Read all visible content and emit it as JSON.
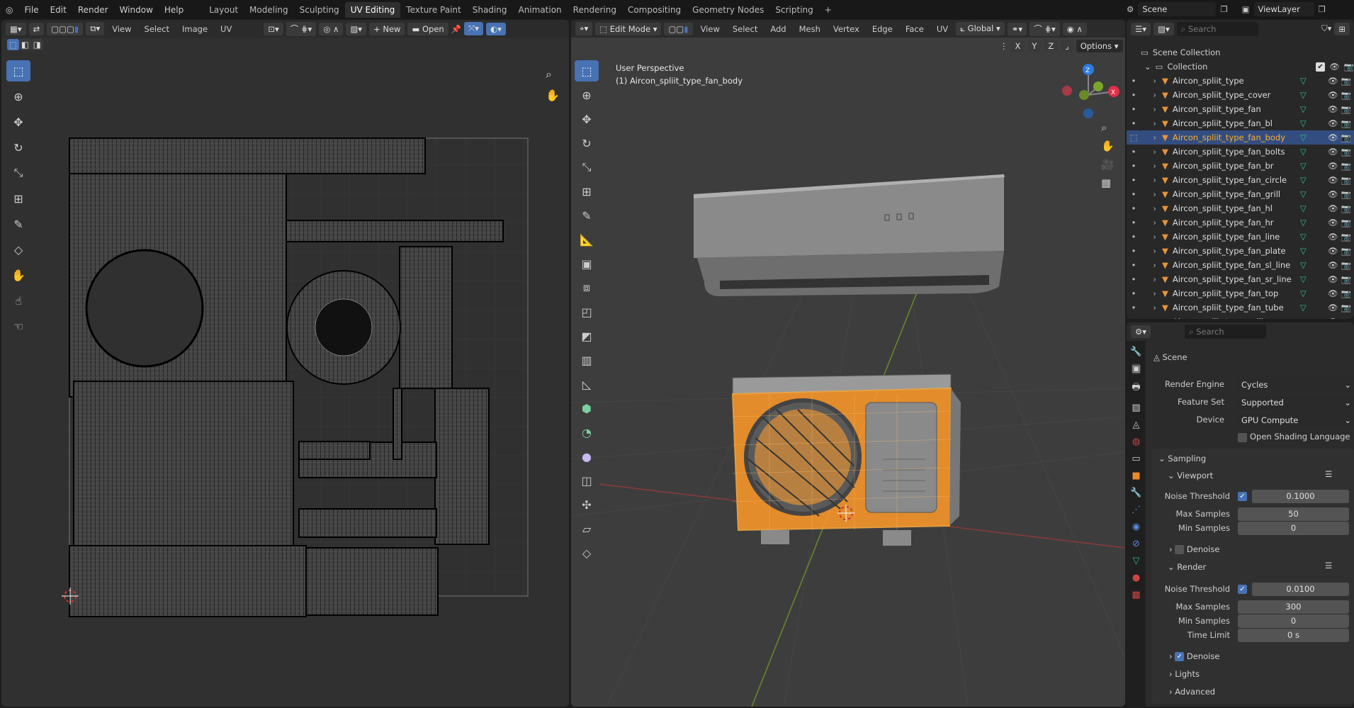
{
  "menu": {
    "items": [
      "File",
      "Edit",
      "Render",
      "Window",
      "Help"
    ],
    "workspaces": [
      "Layout",
      "Modeling",
      "Sculpting",
      "UV Editing",
      "Texture Paint",
      "Shading",
      "Animation",
      "Rendering",
      "Compositing",
      "Geometry Nodes",
      "Scripting"
    ],
    "active_workspace": "UV Editing",
    "add": "+"
  },
  "scene": {
    "name": "Scene",
    "view_layer": "ViewLayer"
  },
  "uv_editor": {
    "menus": [
      "View",
      "Select",
      "Image",
      "UV"
    ],
    "new_label": "New",
    "open_label": "Open"
  },
  "viewport": {
    "mode": "Edit Mode",
    "menus": [
      "View",
      "Select",
      "Add",
      "Mesh",
      "Vertex",
      "Edge",
      "Face",
      "UV"
    ],
    "orientation": "Global",
    "axes": [
      "X",
      "Y",
      "Z"
    ],
    "options": "Options",
    "overlay_title": "User Perspective",
    "overlay_object": "(1) Aircon_spliit_type_fan_body"
  },
  "outliner": {
    "search_placeholder": "Search",
    "scene_collection": "Scene Collection",
    "collection": "Collection",
    "items": [
      "Aircon_spliit_type",
      "Aircon_spliit_type_cover",
      "Aircon_spliit_type_fan",
      "Aircon_spliit_type_fan_bl",
      "Aircon_spliit_type_fan_body",
      "Aircon_spliit_type_fan_bolts",
      "Aircon_spliit_type_fan_br",
      "Aircon_spliit_type_fan_circle",
      "Aircon_spliit_type_fan_grill",
      "Aircon_spliit_type_fan_hl",
      "Aircon_spliit_type_fan_hr",
      "Aircon_spliit_type_fan_line",
      "Aircon_spliit_type_fan_plate",
      "Aircon_spliit_type_fan_sl_line",
      "Aircon_spliit_type_fan_sr_line",
      "Aircon_spliit_type_fan_top",
      "Aircon_spliit_type_fan_tube",
      "Aircon_spliit_type_grill"
    ],
    "selected_index": 4
  },
  "properties": {
    "search_placeholder": "Search",
    "context": "Scene",
    "render_engine_label": "Render Engine",
    "render_engine": "Cycles",
    "feature_set_label": "Feature Set",
    "feature_set": "Supported",
    "device_label": "Device",
    "device": "GPU Compute",
    "osl_label": "Open Shading Language",
    "sampling": "Sampling",
    "viewport": "Viewport",
    "render": "Render",
    "noise_threshold_label": "Noise Threshold",
    "max_samples_label": "Max Samples",
    "min_samples_label": "Min Samples",
    "time_limit_label": "Time Limit",
    "denoise_label": "Denoise",
    "vp_noise_threshold": "0.1000",
    "vp_max_samples": "50",
    "vp_min_samples": "0",
    "r_noise_threshold": "0.0100",
    "r_max_samples": "300",
    "r_min_samples": "0",
    "r_time_limit": "0 s",
    "lights": "Lights",
    "advanced": "Advanced"
  },
  "colors": {
    "accent": "#4772b3",
    "selection": "#ff8c1a",
    "background": "#303030"
  }
}
